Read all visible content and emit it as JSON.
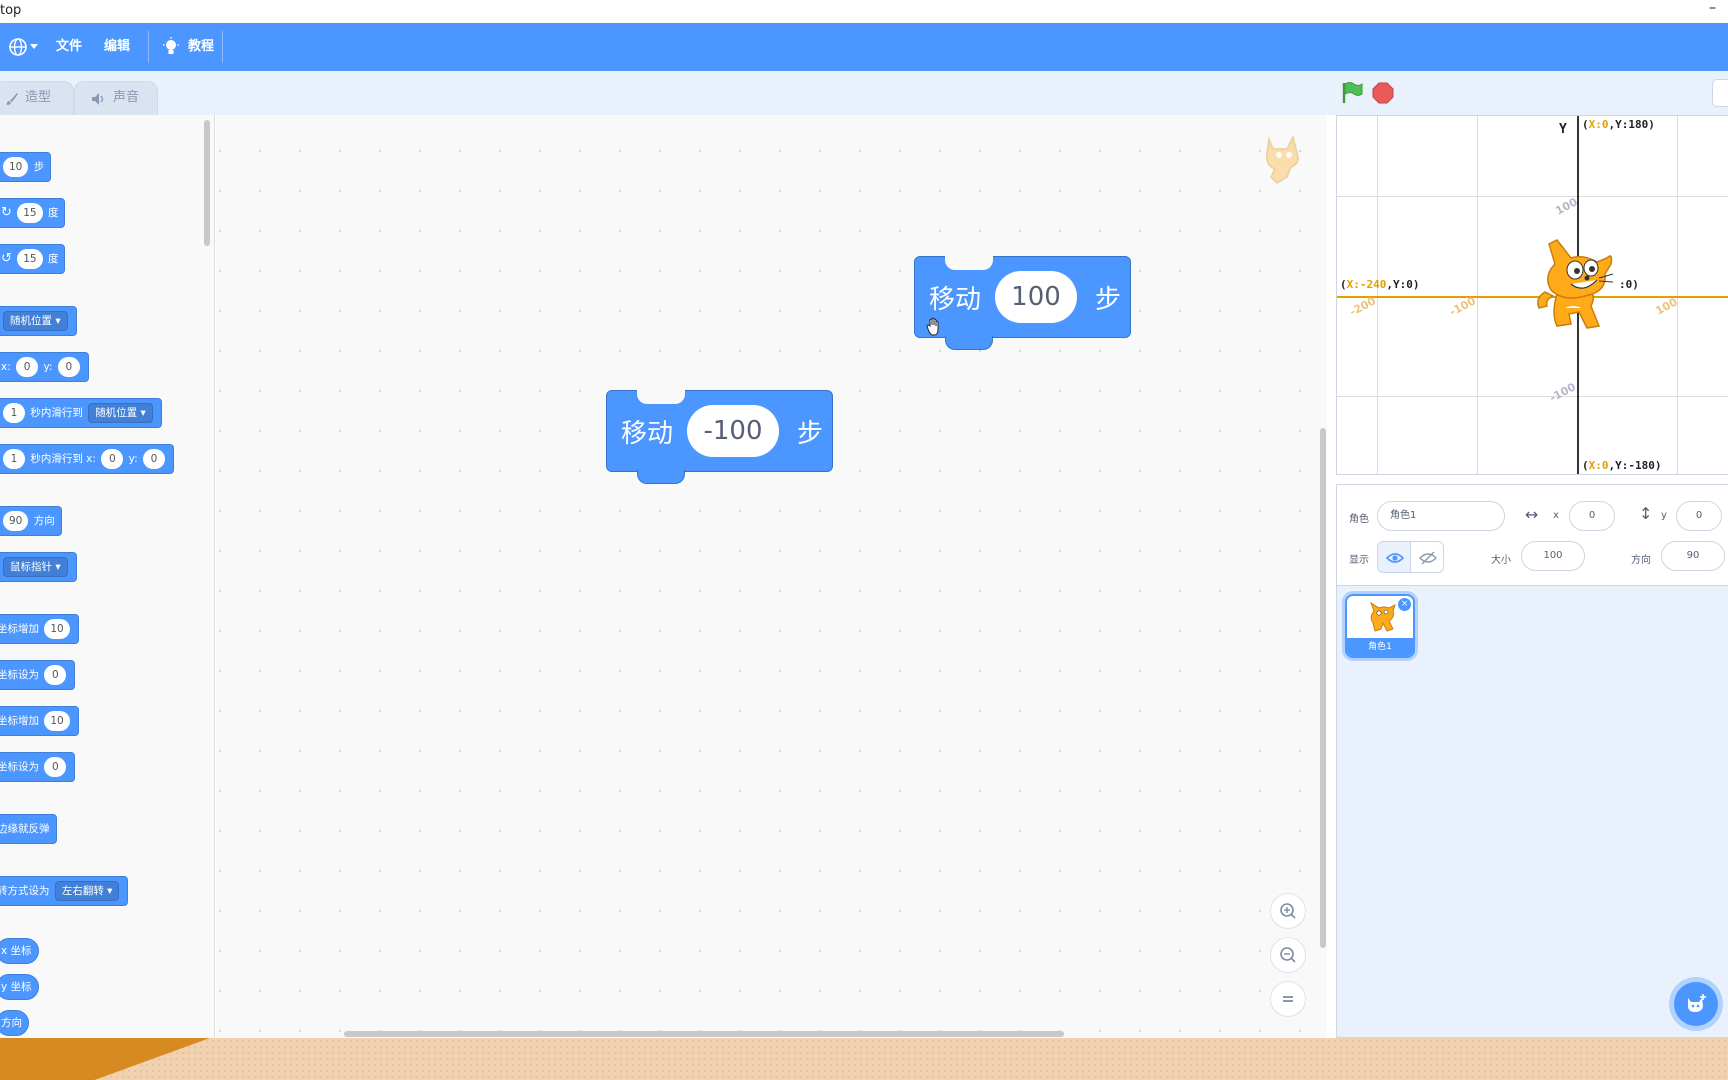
{
  "window": {
    "title": "top",
    "minimize_glyph": "–"
  },
  "menubar": {
    "file": "文件",
    "edit": "编辑",
    "tutorials": "教程"
  },
  "tabs": {
    "costumes": "造型",
    "sounds": "声音"
  },
  "palette": {
    "move_steps": "10",
    "move_unit": "步",
    "turn_right_deg": "15",
    "turn_left_deg": "15",
    "deg_unit": "度",
    "goto_random": "随机位置",
    "goto_x_label": "x:",
    "goto_x": "0",
    "goto_y_label": "y:",
    "goto_y": "0",
    "glide1_secs": "1",
    "glide1_text": "秒内滑行到",
    "glide1_target": "随机位置",
    "glide2_secs": "1",
    "glide2_text": "秒内滑行到 x:",
    "glide2_x": "0",
    "glide2_y_label": "y:",
    "glide2_y": "0",
    "point_dir": "90",
    "point_dir_label": "方向",
    "point_towards": "鼠标指针",
    "change_x_label": "坐标增加",
    "change_x": "10",
    "set_x_label": "坐标设为",
    "set_x": "0",
    "change_y_label": "坐标增加",
    "change_y": "10",
    "set_y_label": "坐标设为",
    "set_y": "0",
    "bounce": "边缘就反弹",
    "rotation_style_label": "转方式设为",
    "rotation_style": "左右翻转",
    "x_position": "x 坐标",
    "y_position": "y 坐标",
    "direction": "方向"
  },
  "workspace": {
    "block_a": {
      "label": "移动",
      "value": "100",
      "unit": "步"
    },
    "block_b": {
      "label": "移动",
      "value": "-100",
      "unit": "步"
    }
  },
  "stage": {
    "y_axis_label": "Y",
    "top_x": "X:0",
    "top_y": ",Y:180)",
    "left_x": "X:-240",
    "left_y": ",Y:0)",
    "right_partial": ":0)",
    "bottom_x": "X:0",
    "bottom_y": ",Y:-180)",
    "ticks": {
      "y100": "100",
      "yneg100": "-100",
      "xneg200": "-200",
      "xneg100": "-100",
      "x100": "100"
    }
  },
  "sprite_info": {
    "sprite_label": "角色",
    "sprite_name": "角色1",
    "x_label": "x",
    "x_value": "0",
    "y_label": "y",
    "y_value": "0",
    "show_label": "显示",
    "size_label": "大小",
    "size_value": "100",
    "direction_label": "方向",
    "direction_value": "90"
  },
  "sprite_list": {
    "sprite1_name": "角色1",
    "delete_glyph": "×"
  },
  "colors": {
    "motion_blue": "#4c97ff",
    "menu_blue": "#4c97ff",
    "flag_green": "#4cbf56",
    "stop_red": "#ec5959"
  }
}
